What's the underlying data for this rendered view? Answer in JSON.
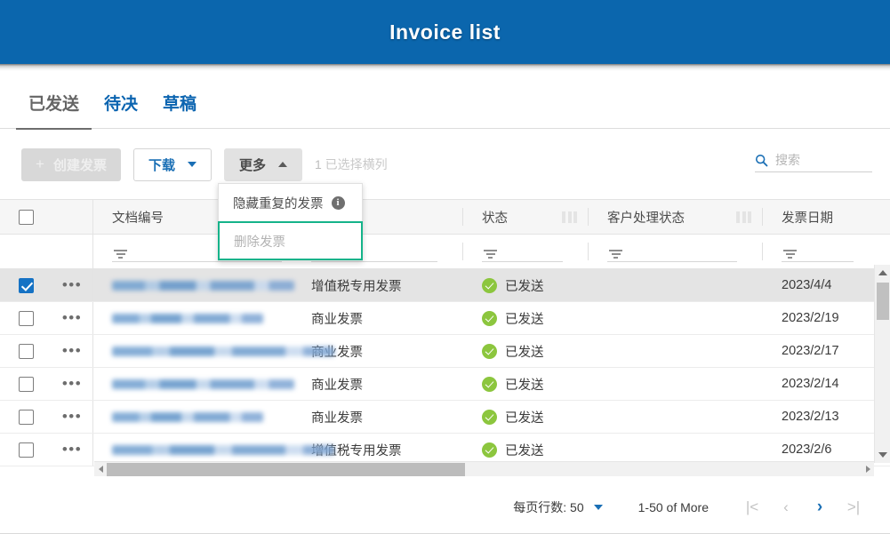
{
  "window": {
    "title": "Invoice list"
  },
  "tabs": [
    {
      "label": "已发送",
      "active": true
    },
    {
      "label": "待决",
      "active": false
    },
    {
      "label": "草稿",
      "active": false
    }
  ],
  "toolbar": {
    "create_label": "创建发票",
    "create_plus": "+",
    "download_label": "下载",
    "more_label": "更多",
    "selection_count": "1",
    "selection_text": "已选择横列"
  },
  "search": {
    "placeholder": "搜索",
    "value": "",
    "icon": "search-icon"
  },
  "more_menu": {
    "items": [
      {
        "label": "隐藏重复的发票",
        "disabled": false,
        "highlighted": false,
        "info_icon": "i"
      },
      {
        "label": "删除发票",
        "disabled": true,
        "highlighted": true
      }
    ],
    "highlight_color": "#15b38a"
  },
  "table": {
    "columns": [
      {
        "key": "doc_no",
        "label": "文档编号"
      },
      {
        "key": "type",
        "label": ""
      },
      {
        "key": "status",
        "label": "状态"
      },
      {
        "key": "customer_status",
        "label": "客户处理状态"
      },
      {
        "key": "invoice_date",
        "label": "发票日期"
      }
    ],
    "rows": [
      {
        "selected": true,
        "doc_no": "",
        "type": "增值税专用发票",
        "status": "已发送",
        "customer_status": "",
        "invoice_date": "2023/4/4"
      },
      {
        "selected": false,
        "doc_no": "",
        "type": "商业发票",
        "status": "已发送",
        "customer_status": "",
        "invoice_date": "2023/2/19"
      },
      {
        "selected": false,
        "doc_no": "",
        "type": "商业发票",
        "status": "已发送",
        "customer_status": "",
        "invoice_date": "2023/2/17"
      },
      {
        "selected": false,
        "doc_no": "",
        "type": "商业发票",
        "status": "已发送",
        "customer_status": "",
        "invoice_date": "2023/2/14"
      },
      {
        "selected": false,
        "doc_no": "",
        "type": "商业发票",
        "status": "已发送",
        "customer_status": "",
        "invoice_date": "2023/2/13"
      },
      {
        "selected": false,
        "doc_no": "",
        "type": "增值税专用发票",
        "status": "已发送",
        "customer_status": "",
        "invoice_date": "2023/2/6"
      }
    ]
  },
  "pagination": {
    "rows_per_page_label": "每页行数: 50",
    "range_label": "1-50 of More",
    "first_icon": "|<",
    "prev_icon": "‹",
    "next_icon": "›",
    "last_icon": ">|"
  },
  "colors": {
    "header_blue": "#0b66ad",
    "link_blue": "#0b64b0",
    "accent_blue": "#1572c4",
    "status_green": "#8cc63e",
    "highlight_teal": "#15b38a"
  }
}
